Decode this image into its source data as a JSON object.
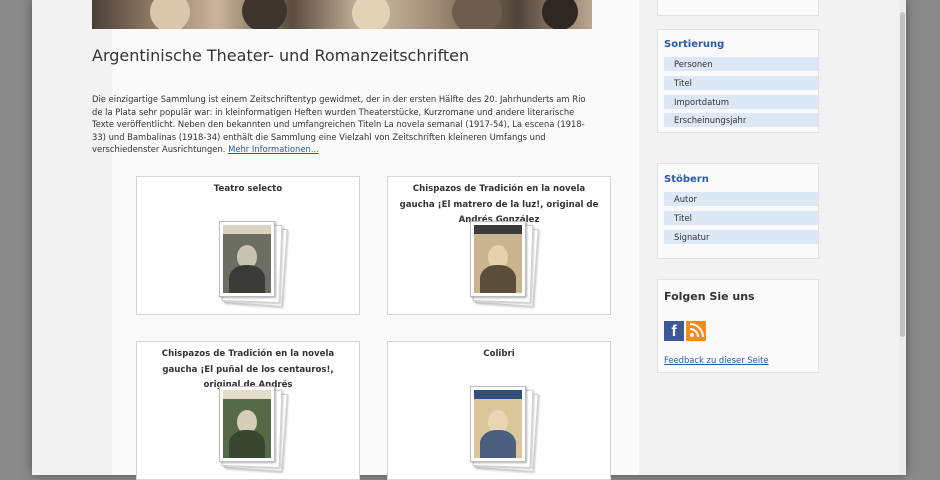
{
  "header": {
    "title": "Argentinische Theater- und Romanzeitschriften"
  },
  "intro": {
    "text": "Die einzigartige Sammlung ist einem Zeitschriftentyp gewidmet, der in der ersten Hälfte des 20. Jahrhunderts am Rio de la Plata sehr populär war: in kleinformatigen Heften wurden Theaterstücke, Kurzromane und andere literarische Texte veröffentlicht. Neben den bekannten und umfangreichen Titeln La novela semanal (1917-54), La escena (1918-33) und Bambalinas (1918-34) enthält die Sammlung eine Vielzahl von Zeitschriften kleineren Umfangs und verschiedenster Ausrichtungen.",
    "more_link": "Mehr Informationen..."
  },
  "cards": [
    {
      "title": "Teatro selecto"
    },
    {
      "title": "Chispazos de Tradición en la novela gaucha ¡El matrero de la luz!, original de Andrés González"
    },
    {
      "title": "Chispazos de Tradición en la novela gaucha ¡El puñal de los centauros!, original de Andrés"
    },
    {
      "title": "Colibri"
    }
  ],
  "sidebar": {
    "sort": {
      "title": "Sortierung",
      "items": [
        "Personen",
        "Titel",
        "Importdatum",
        "Erscheinungsjahr"
      ]
    },
    "browse": {
      "title": "Stöbern",
      "items": [
        "Autor",
        "Titel",
        "Signatur"
      ]
    },
    "follow": {
      "title": "Folgen Sie uns",
      "facebook_glyph": "f",
      "feedback_link": "Feedback zu dieser Seite"
    }
  },
  "colors": {
    "link": "#2a5aa8",
    "sidebar_item_bg": "#dde8f6",
    "facebook": "#3b5998",
    "rss": "#f58a1f"
  },
  "icons": [
    "facebook-icon",
    "rss-icon"
  ]
}
